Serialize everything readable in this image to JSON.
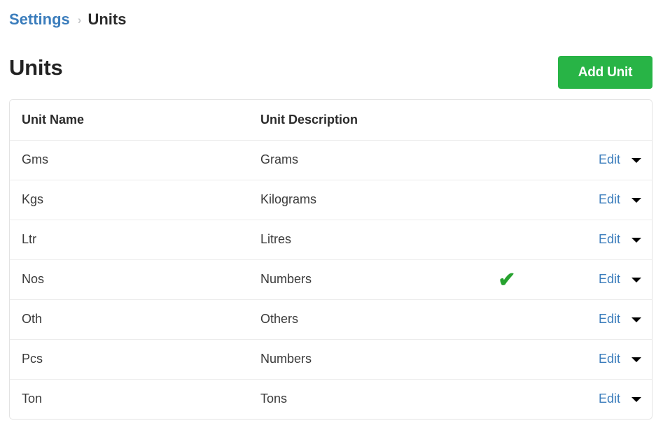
{
  "breadcrumb": {
    "parent_label": "Settings",
    "separator": "›",
    "current_label": "Units"
  },
  "header": {
    "title": "Units",
    "add_button_label": "Add Unit",
    "add_button_color": "#28b446"
  },
  "table": {
    "columns": [
      "Unit Name",
      "Unit Description",
      "",
      ""
    ],
    "action_label": "Edit",
    "caret_icon": "chevron-down-icon",
    "check_icon": "✔",
    "check_color": "#27a22f",
    "link_color": "#3b7dbc",
    "rows": [
      {
        "name": "Gms",
        "description": "Grams",
        "is_default": false,
        "action": "Edit"
      },
      {
        "name": "Kgs",
        "description": "Kilograms",
        "is_default": false,
        "action": "Edit"
      },
      {
        "name": "Ltr",
        "description": "Litres",
        "is_default": false,
        "action": "Edit"
      },
      {
        "name": "Nos",
        "description": "Numbers",
        "is_default": true,
        "action": "Edit"
      },
      {
        "name": "Oth",
        "description": "Others",
        "is_default": false,
        "action": "Edit"
      },
      {
        "name": "Pcs",
        "description": "Numbers",
        "is_default": false,
        "action": "Edit"
      },
      {
        "name": "Ton",
        "description": "Tons",
        "is_default": false,
        "action": "Edit"
      }
    ]
  }
}
